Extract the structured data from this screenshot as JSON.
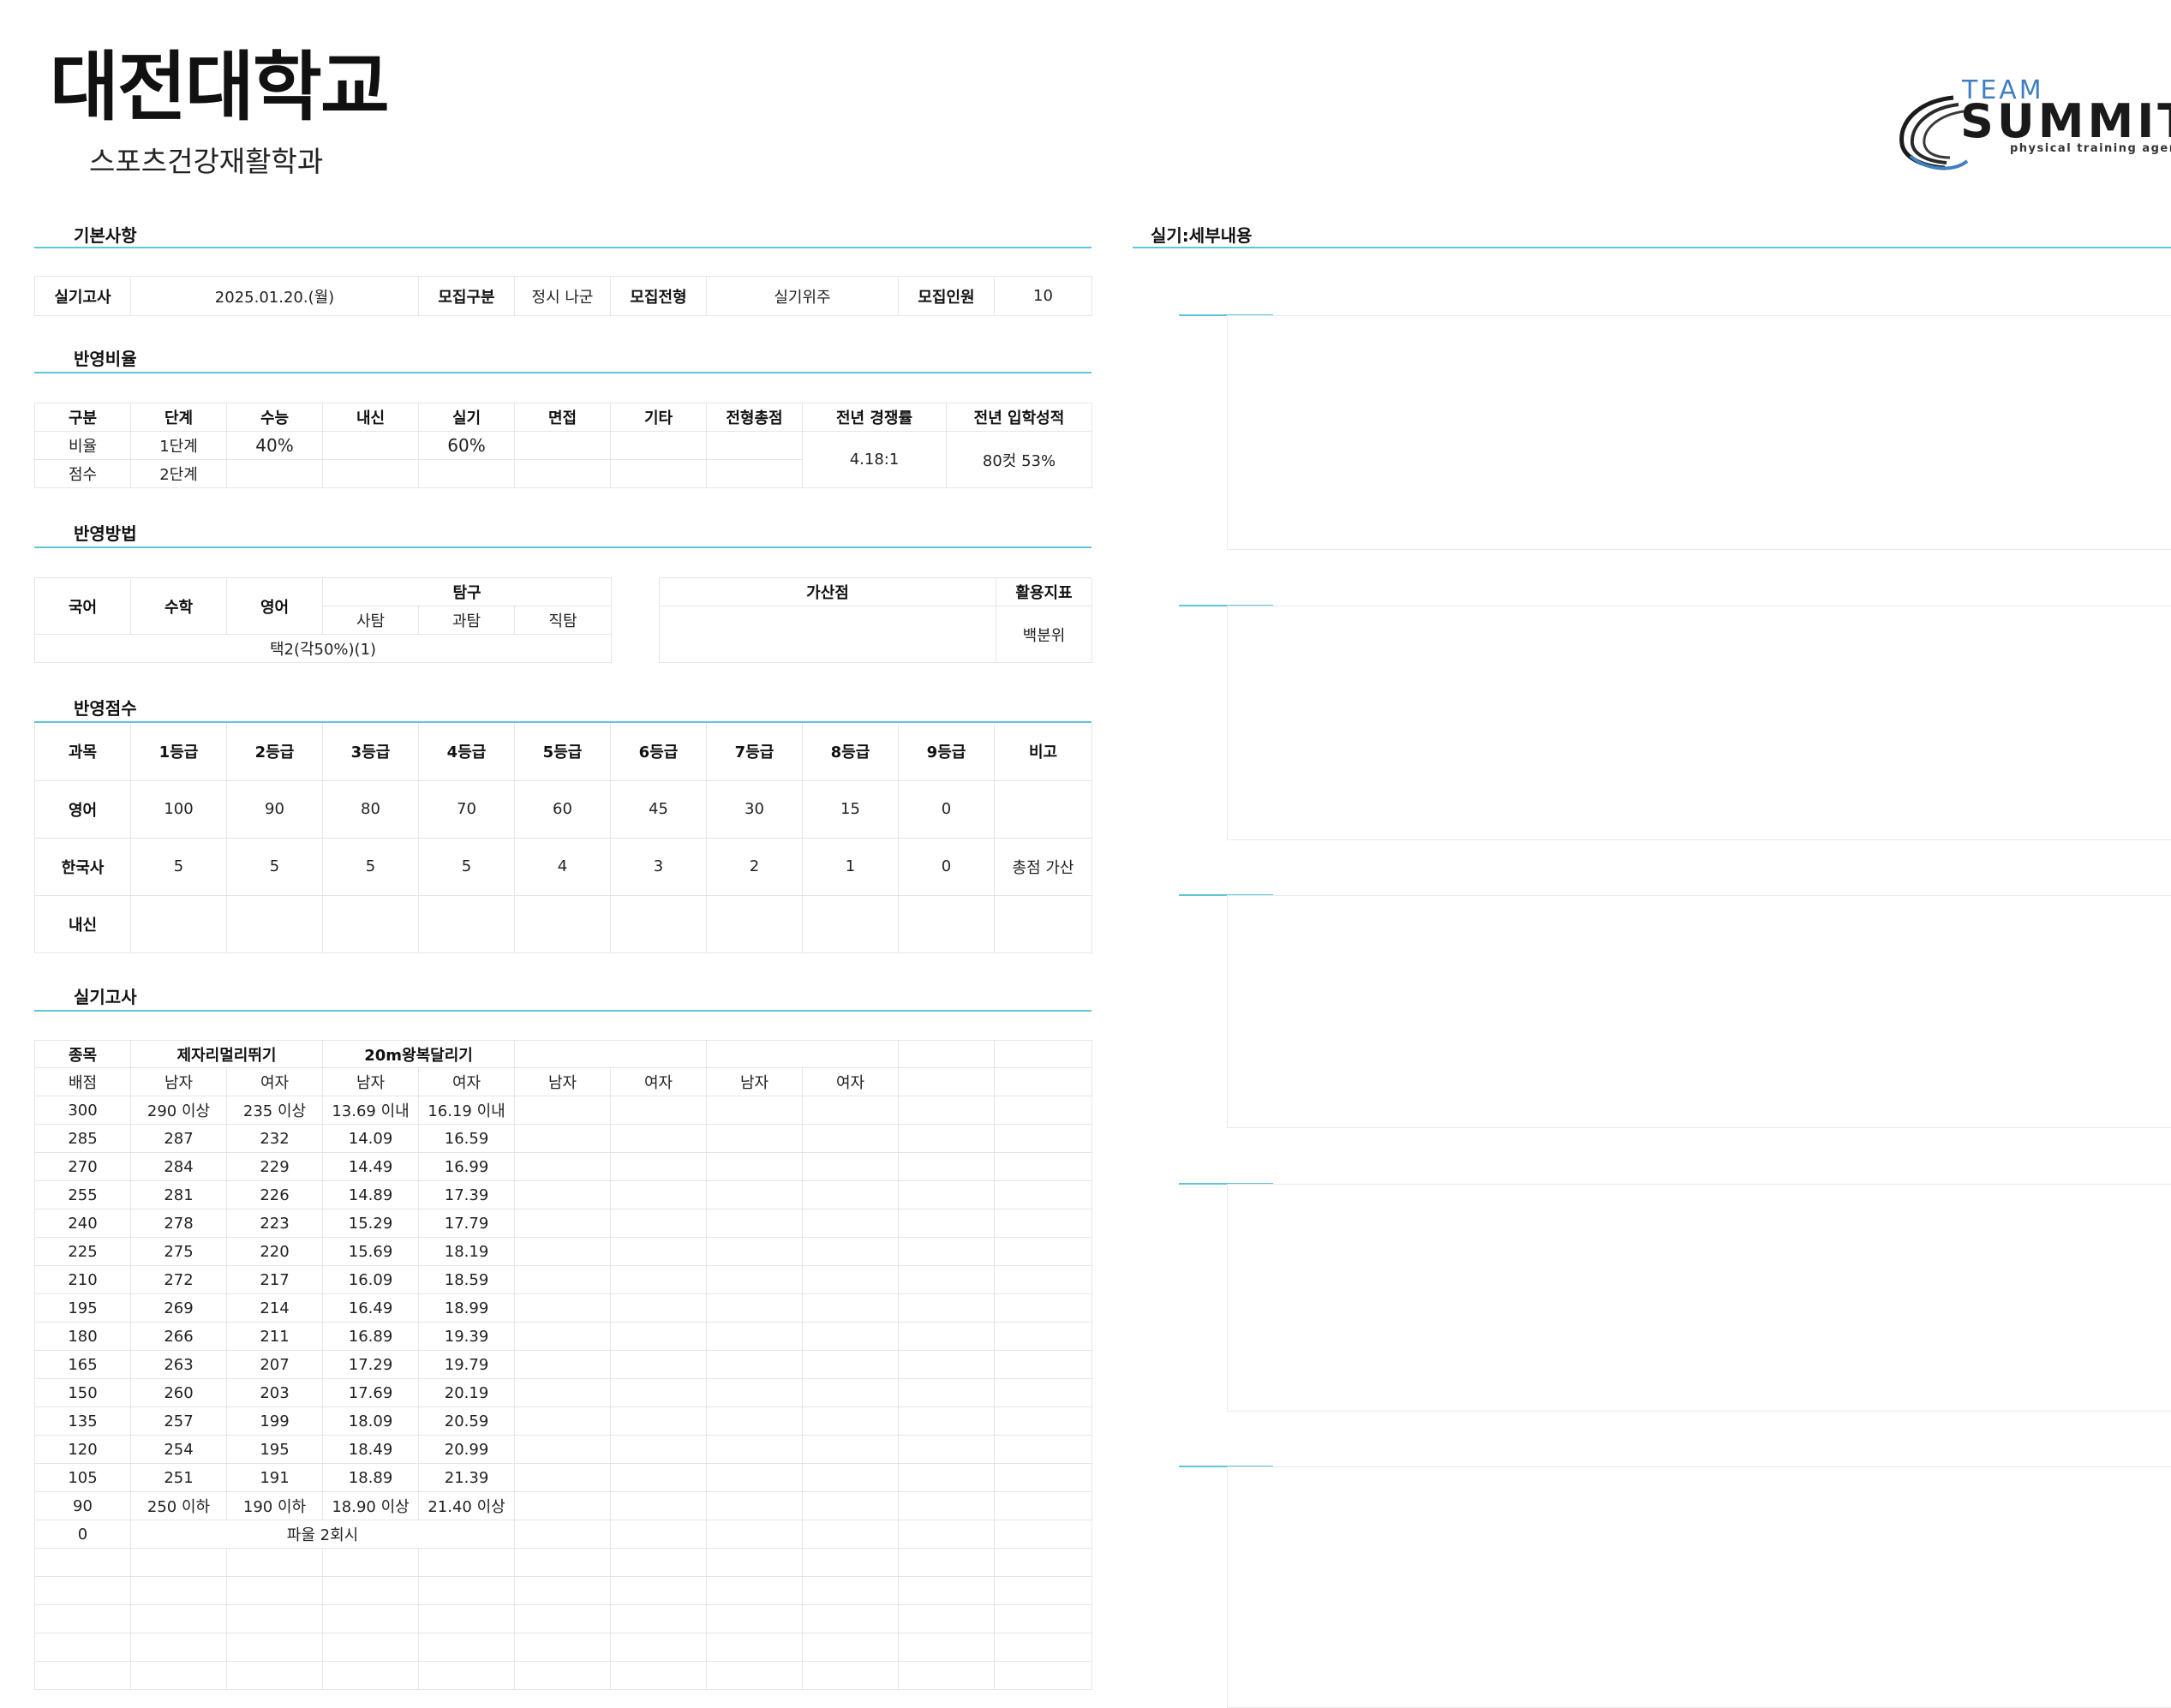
{
  "header": {
    "title": "대전대학교",
    "subtitle": "스포츠건강재활학과",
    "logo": {
      "team": "TEAM",
      "summit": "SUMMIT",
      "agency": "physical training agency"
    }
  },
  "sections": {
    "basic": "기본사항",
    "ratio": "반영비율",
    "method": "반영방법",
    "score": "반영점수",
    "practical": "실기고사",
    "detail": "실기:세부내용"
  },
  "basic": {
    "exam_label": "실기고사",
    "exam_date": "2025.01.20.(월)",
    "type_label": "모집구분",
    "type_value": "정시 나군",
    "form_label": "모집전형",
    "form_value": "실기위주",
    "count_label": "모집인원",
    "count_value": "10"
  },
  "ratio": {
    "headers": [
      "구분",
      "단계",
      "수능",
      "내신",
      "실기",
      "면접",
      "기타",
      "전형총점",
      "전년 경쟁률",
      "전년 입학성적"
    ],
    "row1": [
      "비율",
      "1단계",
      "40%",
      "",
      "60%",
      "",
      "",
      ""
    ],
    "row2": [
      "점수",
      "2단계",
      "",
      "",
      "",
      "",
      "",
      ""
    ],
    "competition": "4.18:1",
    "admission": "80컷 53%"
  },
  "method": {
    "korean": "국어",
    "math": "수학",
    "english": "영어",
    "inquiry": "탐구",
    "social": "사탐",
    "science": "과탐",
    "vocational": "직탐",
    "choice": "택2(각50%)(1)",
    "bonus_label": "가산점",
    "bonus_value": "",
    "index_label": "활용지표",
    "index_value": "백분위"
  },
  "score": {
    "headers": [
      "과목",
      "1등급",
      "2등급",
      "3등급",
      "4등급",
      "5등급",
      "6등급",
      "7등급",
      "8등급",
      "9등급",
      "비고"
    ],
    "rows": [
      [
        "영어",
        "100",
        "90",
        "80",
        "70",
        "60",
        "45",
        "30",
        "15",
        "0",
        ""
      ],
      [
        "한국사",
        "5",
        "5",
        "5",
        "5",
        "4",
        "3",
        "2",
        "1",
        "0",
        "총점 가산"
      ],
      [
        "내신",
        "",
        "",
        "",
        "",
        "",
        "",
        "",
        "",
        "",
        ""
      ]
    ]
  },
  "practical": {
    "item_label": "종목",
    "event1": "제자리멀리뛰기",
    "event2": "20m왕복달리기",
    "score_label": "배점",
    "male": "남자",
    "female": "여자",
    "rows": [
      [
        "300",
        "290 이상",
        "235 이상",
        "13.69 이내",
        "16.19 이내"
      ],
      [
        "285",
        "287",
        "232",
        "14.09",
        "16.59"
      ],
      [
        "270",
        "284",
        "229",
        "14.49",
        "16.99"
      ],
      [
        "255",
        "281",
        "226",
        "14.89",
        "17.39"
      ],
      [
        "240",
        "278",
        "223",
        "15.29",
        "17.79"
      ],
      [
        "225",
        "275",
        "220",
        "15.69",
        "18.19"
      ],
      [
        "210",
        "272",
        "217",
        "16.09",
        "18.59"
      ],
      [
        "195",
        "269",
        "214",
        "16.49",
        "18.99"
      ],
      [
        "180",
        "266",
        "211",
        "16.89",
        "19.39"
      ],
      [
        "165",
        "263",
        "207",
        "17.29",
        "19.79"
      ],
      [
        "150",
        "260",
        "203",
        "17.69",
        "20.19"
      ],
      [
        "135",
        "257",
        "199",
        "18.09",
        "20.59"
      ],
      [
        "120",
        "254",
        "195",
        "18.49",
        "20.99"
      ],
      [
        "105",
        "251",
        "191",
        "18.89",
        "21.39"
      ],
      [
        "90",
        "250 이하",
        "190 이하",
        "18.90 이상",
        "21.40 이상"
      ]
    ],
    "foul_score": "0",
    "foul_text": "파울 2회시"
  }
}
